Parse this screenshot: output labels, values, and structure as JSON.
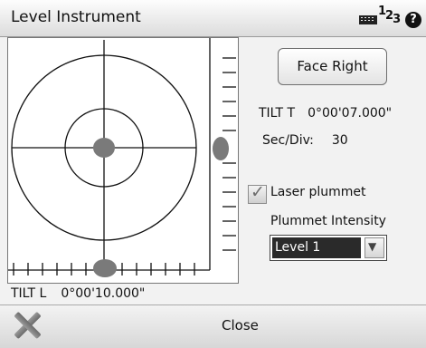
{
  "window": {
    "title": "Level Instrument",
    "keyboard_icon": "keyboard-icon",
    "input_mode": {
      "d1": "1",
      "d2": "2",
      "d3": "3",
      "icon": "input-mode-123-icon"
    },
    "help_symbol": "?"
  },
  "tilt_l": {
    "label": "TILT L",
    "value": "0°00'10.000\""
  },
  "controls": {
    "face_button": "Face Right",
    "tilt_t": {
      "label": "TILT T",
      "value": "0°00'07.000\""
    },
    "sec_div": {
      "label": "Sec/Div:",
      "value": "30"
    },
    "laser_plummet": {
      "label": "Laser plummet",
      "checked": true
    },
    "plummet_intensity": {
      "label": "Plummet Intensity",
      "selected": "Level 1"
    }
  },
  "footer": {
    "close_label": "Close",
    "close_icon": "close-x-icon"
  },
  "colors": {
    "bubble": "#7a7a7a",
    "selection": "#2a2a2a",
    "panel_bg": "#f2f2f2"
  }
}
